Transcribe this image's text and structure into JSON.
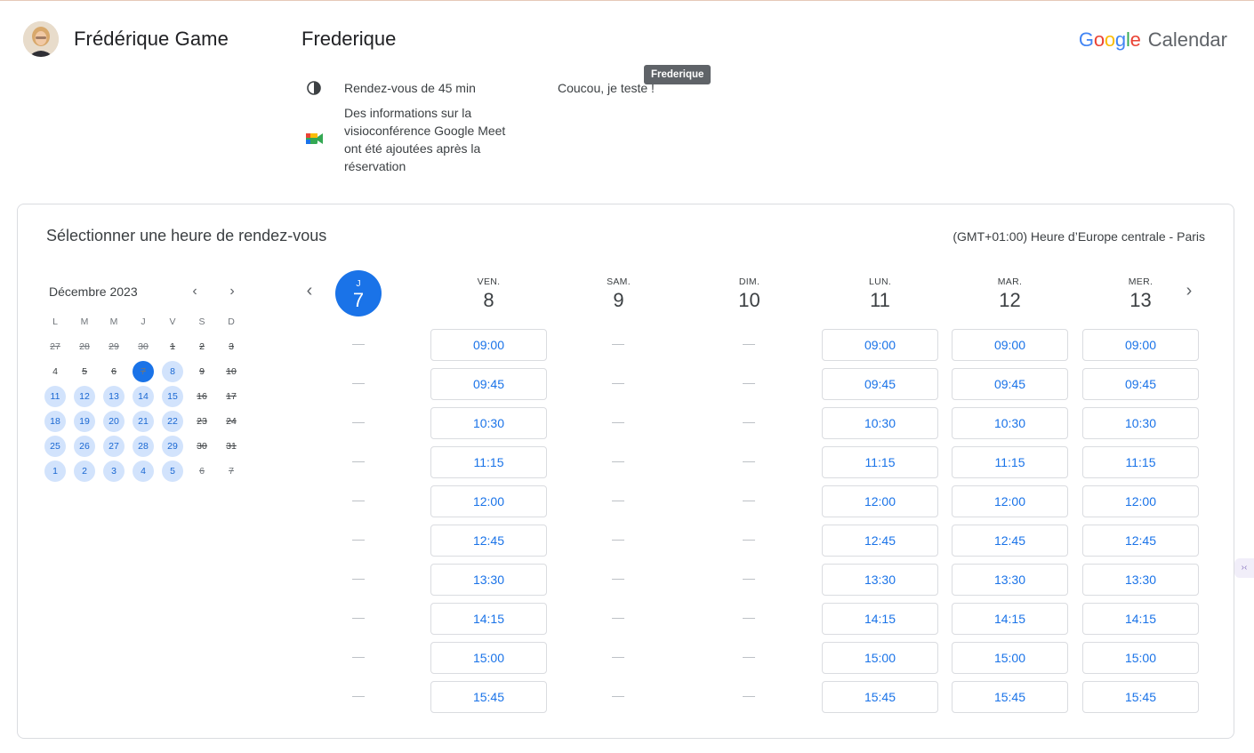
{
  "host": {
    "name": "Frédérique Game"
  },
  "page": {
    "title": "Frederique",
    "description": "Coucou, je teste !",
    "tooltip": "Frederique"
  },
  "brand": {
    "google": "Google",
    "product": "Calendar"
  },
  "info": {
    "duration": "Rendez-vous de 45 min",
    "meet_line1": "Des informations sur la",
    "meet_line2": "visioconférence Google Meet",
    "meet_line3": "ont été ajoutées après la",
    "meet_line4": "réservation"
  },
  "booking": {
    "title": "Sélectionner une heure de rendez-vous",
    "timezone": "(GMT+01:00) Heure d’Europe centrale - Paris"
  },
  "mini_calendar": {
    "month_label": "Décembre 2023",
    "prev_icon": "chevron-left-icon",
    "next_icon": "chevron-right-icon",
    "weekdays": [
      "L",
      "M",
      "M",
      "J",
      "V",
      "S",
      "D"
    ],
    "weeks": [
      [
        {
          "d": "27",
          "s": "past"
        },
        {
          "d": "28",
          "s": "past"
        },
        {
          "d": "29",
          "s": "past"
        },
        {
          "d": "30",
          "s": "past"
        },
        {
          "d": "1",
          "s": "past-strong"
        },
        {
          "d": "2",
          "s": "past-strong"
        },
        {
          "d": "3",
          "s": "past-strong"
        }
      ],
      [
        {
          "d": "4",
          "s": "plain"
        },
        {
          "d": "5",
          "s": "past-strong"
        },
        {
          "d": "6",
          "s": "past-strong"
        },
        {
          "d": "7",
          "s": "selected"
        },
        {
          "d": "8",
          "s": "avail"
        },
        {
          "d": "9",
          "s": "past-strong"
        },
        {
          "d": "10",
          "s": "past-strong"
        }
      ],
      [
        {
          "d": "11",
          "s": "avail"
        },
        {
          "d": "12",
          "s": "avail"
        },
        {
          "d": "13",
          "s": "avail"
        },
        {
          "d": "14",
          "s": "avail"
        },
        {
          "d": "15",
          "s": "avail"
        },
        {
          "d": "16",
          "s": "past-strong"
        },
        {
          "d": "17",
          "s": "past-strong"
        }
      ],
      [
        {
          "d": "18",
          "s": "avail"
        },
        {
          "d": "19",
          "s": "avail"
        },
        {
          "d": "20",
          "s": "avail"
        },
        {
          "d": "21",
          "s": "avail"
        },
        {
          "d": "22",
          "s": "avail"
        },
        {
          "d": "23",
          "s": "past-strong"
        },
        {
          "d": "24",
          "s": "past-strong"
        }
      ],
      [
        {
          "d": "25",
          "s": "avail"
        },
        {
          "d": "26",
          "s": "avail"
        },
        {
          "d": "27",
          "s": "avail"
        },
        {
          "d": "28",
          "s": "avail"
        },
        {
          "d": "29",
          "s": "avail"
        },
        {
          "d": "30",
          "s": "past-strong"
        },
        {
          "d": "31",
          "s": "past-strong"
        }
      ],
      [
        {
          "d": "1",
          "s": "avail"
        },
        {
          "d": "2",
          "s": "avail"
        },
        {
          "d": "3",
          "s": "avail"
        },
        {
          "d": "4",
          "s": "avail"
        },
        {
          "d": "5",
          "s": "avail"
        },
        {
          "d": "6",
          "s": "past"
        },
        {
          "d": "7",
          "s": "past"
        }
      ]
    ]
  },
  "week": {
    "prev_icon": "chevron-left-icon",
    "next_icon": "chevron-right-icon",
    "days": [
      {
        "dow": "J",
        "num": "7",
        "today": true,
        "slots": []
      },
      {
        "dow": "VEN.",
        "num": "8",
        "slots": [
          "09:00",
          "09:45",
          "10:30",
          "11:15",
          "12:00",
          "12:45",
          "13:30",
          "14:15",
          "15:00",
          "15:45"
        ]
      },
      {
        "dow": "SAM.",
        "num": "9",
        "slots": []
      },
      {
        "dow": "DIM.",
        "num": "10",
        "slots": []
      },
      {
        "dow": "LUN.",
        "num": "11",
        "slots": [
          "09:00",
          "09:45",
          "10:30",
          "11:15",
          "12:00",
          "12:45",
          "13:30",
          "14:15",
          "15:00",
          "15:45"
        ]
      },
      {
        "dow": "MAR.",
        "num": "12",
        "slots": [
          "09:00",
          "09:45",
          "10:30",
          "11:15",
          "12:00",
          "12:45",
          "13:30",
          "14:15",
          "15:00",
          "15:45"
        ]
      },
      {
        "dow": "MER.",
        "num": "13",
        "slots": [
          "09:00",
          "09:45",
          "10:30",
          "11:15",
          "12:00",
          "12:45",
          "13:30",
          "14:15",
          "15:00",
          "15:45"
        ]
      }
    ]
  },
  "colors": {
    "accent": "#1a73e8",
    "available_bg": "#d2e3fc",
    "border": "#dadce0"
  }
}
